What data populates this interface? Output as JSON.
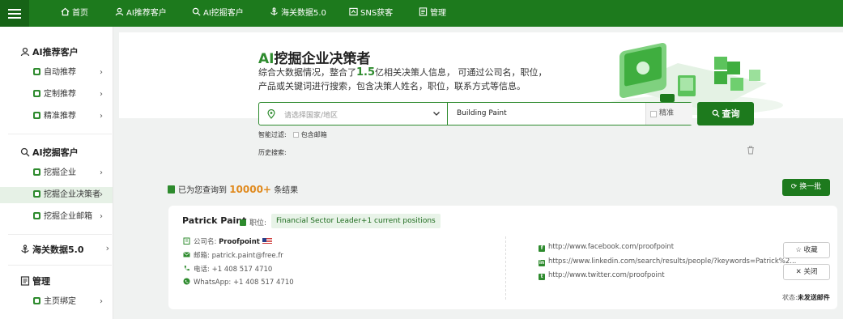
{
  "nav": {
    "home": "首页",
    "ai_recommend": "AI推荐客户",
    "ai_mine": "AI挖掘客户",
    "customs": "海关数据5.0",
    "sns": "SNS获客",
    "manage": "管理"
  },
  "sidebar": {
    "sections": [
      {
        "label": "AI推荐客户",
        "items": [
          "自动推荐",
          "定制推荐",
          "精准推荐"
        ]
      },
      {
        "label": "AI挖掘客户",
        "items": [
          "挖掘企业",
          "挖掘企业决策者",
          "挖掘企业邮箱"
        ]
      },
      {
        "label": "海关数据5.0"
      },
      {
        "label": "管理",
        "items": [
          "主页绑定"
        ]
      }
    ],
    "active_item": "挖掘企业决策者"
  },
  "hero": {
    "title_ai": "AI",
    "title_rest": "挖掘企业决策者",
    "desc_pre": "综合大数据情况，整合了",
    "desc_num": "1.5",
    "desc_post": "亿相关决策人信息，  可通过公司名，职位，产品或关键词进行搜索，包含决策人姓名，职位，联系方式等信息。"
  },
  "search": {
    "region_placeholder": "请选择国家/地区",
    "keyword": "Building Paint",
    "exact_label": "精准",
    "button_label": "查询"
  },
  "filter": {
    "label": "智能过滤:",
    "include_email": "包含邮箱"
  },
  "history": {
    "label": "历史搜索:"
  },
  "results": {
    "prefix": "已为您查询到",
    "count": "10000+",
    "suffix": "条结果",
    "refresh_label": "换一批"
  },
  "person": {
    "name": "Patrick Paint",
    "position_label": "职位:",
    "position": "Financial Sector Leader+1 current positions",
    "company_label": "公司名:",
    "company": "Proofpoint",
    "email_label": "邮箱:",
    "email": "patrick.paint@free.fr",
    "phone_label": "电话:",
    "phone": "+1 408 517 4710",
    "whatsapp_label": "WhatsApp:",
    "whatsapp": "+1 408 517 4710",
    "links": [
      {
        "icon": "facebook-icon",
        "glyph": "f",
        "url": "http://www.facebook.com/proofpoint"
      },
      {
        "icon": "linkedin-icon",
        "glyph": "in",
        "url": "https://www.linkedin.com/search/results/people/?keywords=Patrick%2..."
      },
      {
        "icon": "twitter-icon",
        "glyph": "t",
        "url": "http://www.twitter.com/proofpoint"
      }
    ],
    "favorite_label": "收藏",
    "close_label": "关闭",
    "status_label": "状态:",
    "status_value": "未发送邮件"
  },
  "colors": {
    "brand_green": "#1d7a1d",
    "accent_orange": "#e08a1e"
  }
}
